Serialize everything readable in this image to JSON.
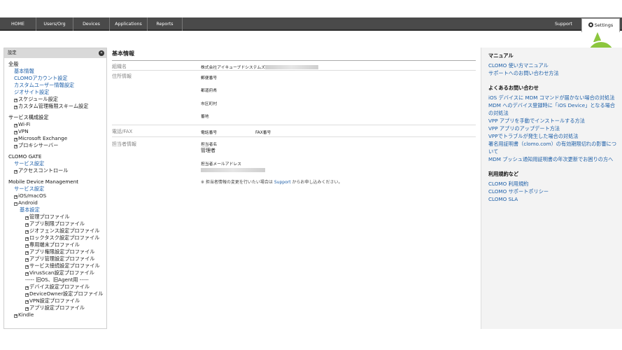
{
  "nav": {
    "items": [
      "HOME",
      "Users/Org",
      "Devices",
      "Applications",
      "Reports"
    ],
    "support": "Support",
    "settings": "Settings"
  },
  "sidebar": {
    "header": "設定",
    "collapse_icon": "«",
    "sections": [
      {
        "title": "全般",
        "items": [
          {
            "label": "基本情報",
            "level": 1,
            "link": true
          },
          {
            "label": "CLOMOアカウント設定",
            "level": 1,
            "link": true
          },
          {
            "label": "カスタムユーザー情報設定",
            "level": 1,
            "link": true
          },
          {
            "label": "ジオサイト設定",
            "level": 1,
            "link": true
          },
          {
            "label": "スケジュール設定",
            "level": 1,
            "exp": true
          },
          {
            "label": "カスタム管理権限スキーム設定",
            "level": 1,
            "exp": true
          }
        ]
      },
      {
        "title": "サービス構成設定",
        "items": [
          {
            "label": "Wi-Fi",
            "level": 1,
            "exp": true
          },
          {
            "label": "VPN",
            "level": 1,
            "exp": true
          },
          {
            "label": "Microsoft Exchange",
            "level": 1,
            "exp": true
          },
          {
            "label": "プロキシサーバー",
            "level": 1,
            "exp": true
          }
        ]
      },
      {
        "title": "CLOMO GATE",
        "items": [
          {
            "label": "サービス設定",
            "level": 1,
            "link": true
          },
          {
            "label": "アクセスコントロール",
            "level": 1,
            "exp": true
          }
        ]
      },
      {
        "title": "Mobile Device Management",
        "items": [
          {
            "label": "サービス設定",
            "level": 1,
            "link": true
          },
          {
            "label": "iOS/macOS",
            "level": 1,
            "exp": true
          },
          {
            "label": "Android",
            "level": 1,
            "exp": true,
            "open": true
          },
          {
            "label": "基本設定",
            "level": 2,
            "link": true
          },
          {
            "label": "管理プロファイル",
            "level": 3,
            "exp": true
          },
          {
            "label": "アプリ制限プロファイル",
            "level": 3,
            "exp": true
          },
          {
            "label": "ジオフェンス設定プロファイル",
            "level": 3,
            "exp": true
          },
          {
            "label": "ロックタスク設定プロファイル",
            "level": 3,
            "exp": true
          },
          {
            "label": "専用端末プロファイル",
            "level": 3,
            "exp": true
          },
          {
            "label": "アプリ権限設定プロファイル",
            "level": 3,
            "exp": true
          },
          {
            "label": "アプリ管理設定プロファイル",
            "level": 3,
            "exp": true
          },
          {
            "label": "サービス接続設定プロファイル",
            "level": 3,
            "exp": true
          },
          {
            "label": "VirusScan設定プロファイル",
            "level": 3,
            "exp": true
          },
          {
            "label": "----- 旧OS、旧Agent用 -----",
            "level": 3
          },
          {
            "label": "デバイス設定プロファイル",
            "level": 3,
            "exp": true
          },
          {
            "label": "DeviceOwner設定プロファイル",
            "level": 3,
            "exp": true
          },
          {
            "label": "VPN設定プロファイル",
            "level": 3,
            "exp": true
          },
          {
            "label": "アプリ設定プロファイル",
            "level": 3,
            "exp": true
          },
          {
            "label": "Kindle",
            "level": 1,
            "exp": true
          }
        ]
      }
    ]
  },
  "main": {
    "title": "基本情報",
    "org_label": "組織名",
    "org_value": "株式会社アイキューブドシステムズ",
    "address_label": "住所情報",
    "postal_label": "郵便番号",
    "pref_label": "都道府県",
    "city_label": "市区町村",
    "street_label": "番地",
    "phone_section_label": "電話/FAX",
    "phone_label": "電話番号",
    "fax_label": "FAX番号",
    "contact_section_label": "担当者情報",
    "contact_name_label": "担当者名",
    "contact_name_value": "管理者",
    "contact_email_label": "担当者メールアドレス",
    "note_prefix": "※ 担当者情報の変更を行いたい場合は ",
    "note_link": "Support",
    "note_suffix": " からお申し込みください。"
  },
  "right": {
    "sections": [
      {
        "title": "マニュアル",
        "links": [
          "CLOMO 使い方マニュアル",
          "サポートへのお問い合わせ方法"
        ]
      },
      {
        "title": "よくあるお問い合わせ",
        "links": [
          "iOS デバイスに MDM コマンドが届かない場合の対処法",
          "MDM へのデバイス登録時に「iOS Device」となる場合の対処法",
          "VPP アプリを手動でインストールする方法",
          "VPP アプリのアップデート方法",
          "VPPでトラブルが発生した場合の対処法",
          "署名用証明書（clomo.com）の有効期限切れの影響について",
          "MDM プッシュ通知用証明書の年次更新でお困りの方へ"
        ]
      },
      {
        "title": "利用規約など",
        "links": [
          "CLOMO 利用規約",
          "CLOMO サポートポリシー",
          "CLOMO SLA"
        ]
      }
    ]
  },
  "callout": "1",
  "colors": {
    "accent_green": "#8cc63e",
    "link_blue": "#1d5fa8",
    "topbar": "#4a4a4a"
  }
}
